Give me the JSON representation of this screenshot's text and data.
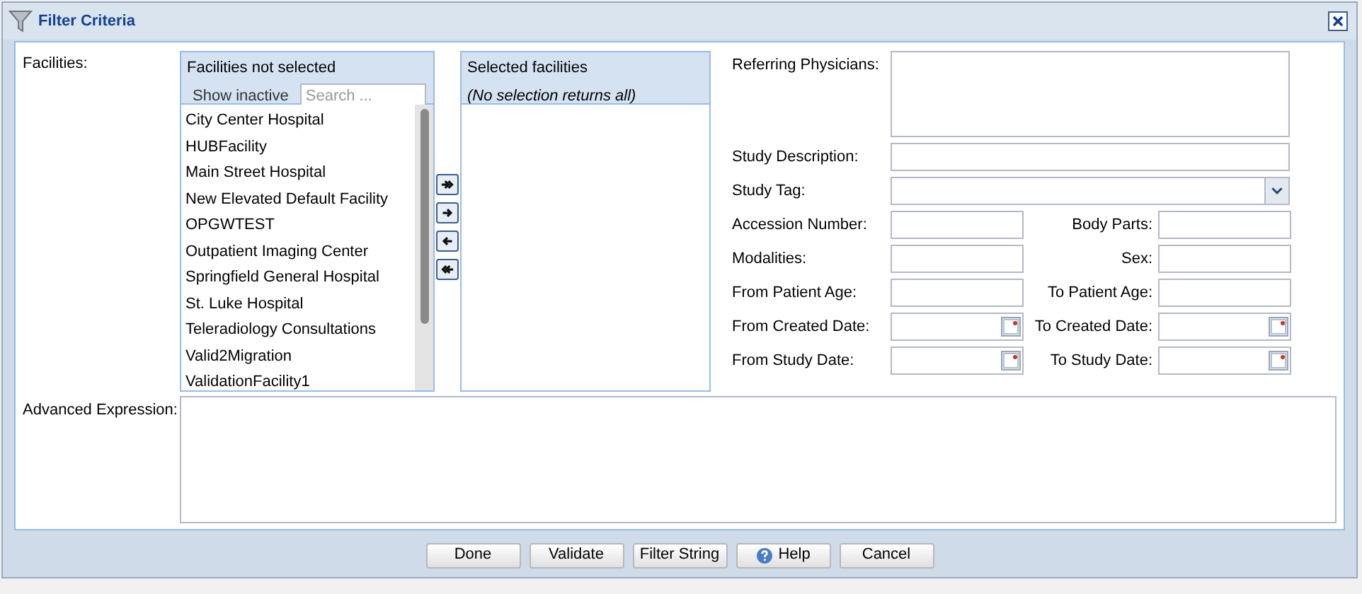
{
  "dialog": {
    "title": "Filter Criteria"
  },
  "facilities": {
    "label": "Facilities:",
    "available": {
      "header": "Facilities not selected",
      "show_inactive": "Show inactive",
      "search": {
        "placeholder": "Search ..."
      },
      "items": [
        "City Center Hospital",
        "HUBFacility",
        "Main Street Hospital",
        "New Elevated Default Facility",
        "OPGWTEST",
        "Outpatient Imaging Center",
        "Springfield General Hospital",
        "St. Luke Hospital",
        "Teleradiology Consultations",
        "Valid2Migration",
        "ValidationFacility1"
      ]
    },
    "selected": {
      "header": "Selected facilities",
      "note": "(No selection returns all)"
    }
  },
  "form": [
    {
      "label": "Referring Physicians:",
      "kind": "textarea"
    },
    {
      "label": "Study Description:",
      "kind": "text"
    },
    {
      "label": "Study Tag:",
      "kind": "select"
    },
    {
      "label": "Accession Number:",
      "kind": "text",
      "right": {
        "label": "Body Parts:",
        "kind": "text"
      }
    },
    {
      "label": "Modalities:",
      "kind": "text",
      "right": {
        "label": "Sex:",
        "kind": "text"
      }
    },
    {
      "label": "From Patient Age:",
      "kind": "text",
      "right": {
        "label": "To Patient Age:",
        "kind": "text"
      }
    },
    {
      "label": "From Created Date:",
      "kind": "date",
      "right": {
        "label": "To Created Date:",
        "kind": "date"
      }
    },
    {
      "label": "From Study Date:",
      "kind": "date",
      "right": {
        "label": "To Study Date:",
        "kind": "date"
      }
    }
  ],
  "advanced": {
    "label": "Advanced Expression:"
  },
  "buttons": [
    {
      "label": "Done",
      "kind": "plain"
    },
    {
      "label": "Validate",
      "kind": "plain"
    },
    {
      "label": "Filter String",
      "kind": "plain"
    },
    {
      "label": "Help",
      "kind": "help"
    },
    {
      "label": "Cancel",
      "kind": "plain"
    }
  ]
}
